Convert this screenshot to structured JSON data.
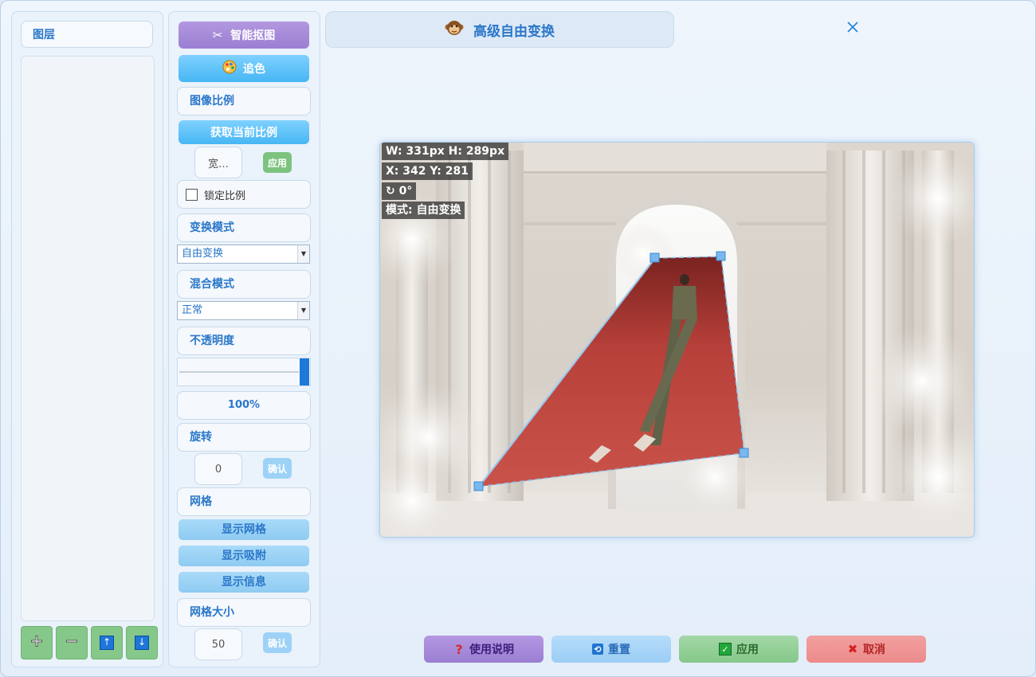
{
  "layers": {
    "header": "图层",
    "buttons": [
      {
        "icon": "add-icon",
        "glyph": "➕"
      },
      {
        "icon": "minus-icon",
        "glyph": "➖"
      },
      {
        "icon": "move-up-icon",
        "glyph": "↑"
      },
      {
        "icon": "move-down-icon",
        "glyph": "↓"
      }
    ]
  },
  "tools": {
    "smart_cutout": "智能抠图",
    "color_match": "追色",
    "image_ratio": "图像比例",
    "get_current_ratio": "获取当前比例",
    "ratio_input_placeholder": "宽…",
    "apply_ratio": "应用",
    "lock_ratio": "锁定比例",
    "transform_mode_label": "变换模式",
    "transform_mode_value": "自由变换",
    "blend_mode_label": "混合模式",
    "blend_mode_value": "正常",
    "opacity_label": "不透明度",
    "opacity_value": "100%",
    "opacity_level": 1.0,
    "rotation_label": "旋转",
    "rotation_value": "0",
    "rotation_confirm": "确认",
    "grid_label": "网格",
    "show_grid": "显示网格",
    "show_snap": "显示吸附",
    "show_info": "显示信息",
    "grid_size_label": "网格大小",
    "grid_size_value": "50",
    "grid_size_confirm": "确认"
  },
  "title": {
    "icon": "monkey-icon",
    "text": "高级自由变换"
  },
  "canvas_info": {
    "size": "W: 331px H: 289px",
    "position": "X: 342 Y: 281",
    "rotation": "↻ 0°",
    "mode": "模式: 自由变换"
  },
  "actions": {
    "help": "使用说明",
    "reset": "重置",
    "apply": "应用",
    "cancel": "取消"
  },
  "colors": {
    "accent": "#2a77c9",
    "purple": "#9a7fd2",
    "green": "#86c88a",
    "red_button": "#ec8a8a"
  }
}
